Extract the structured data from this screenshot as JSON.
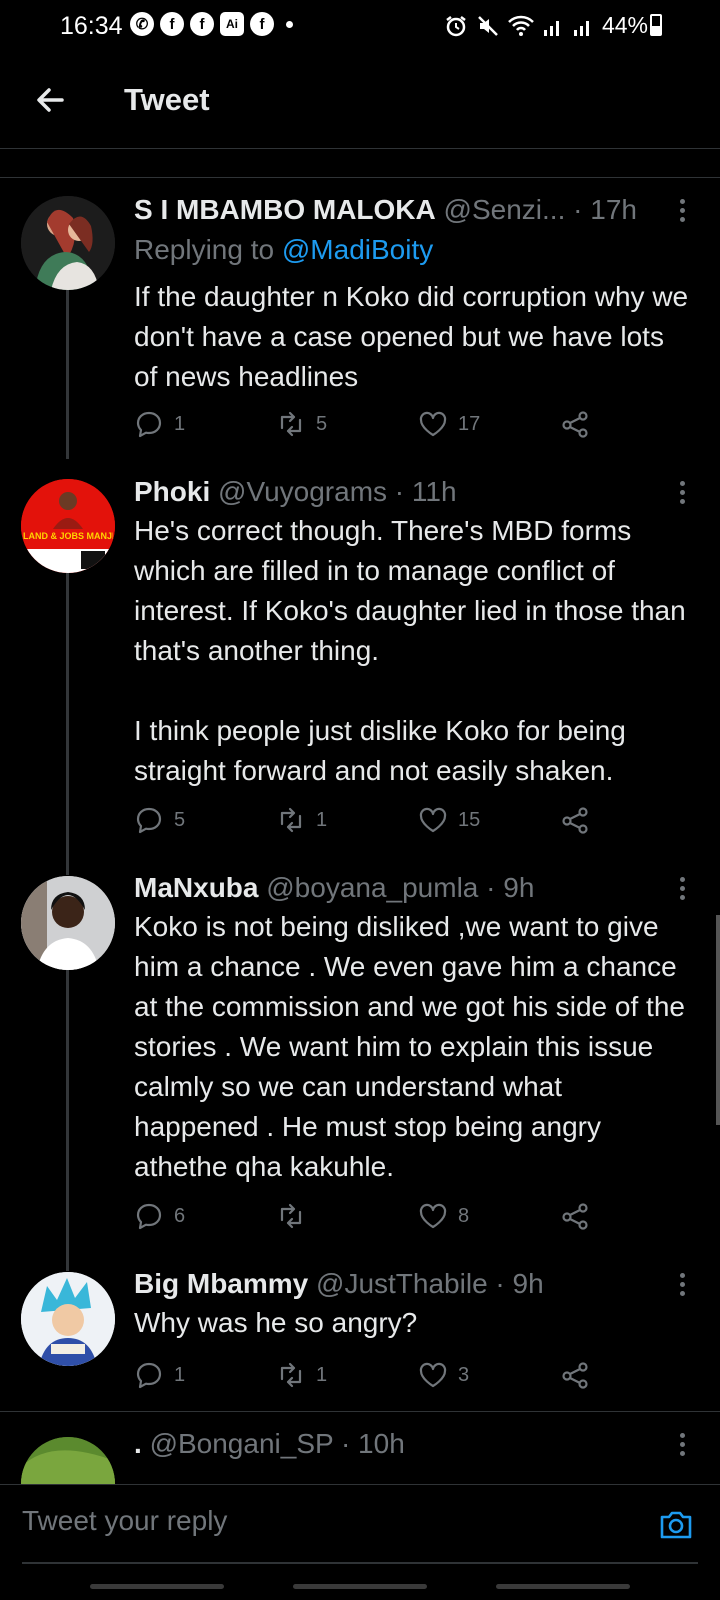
{
  "status_bar": {
    "time": "16:34",
    "notification_icons": [
      "whatsapp-icon",
      "facebook-icon",
      "facebook-icon",
      "ai-icon",
      "facebook-icon"
    ],
    "ai_label": "Ai",
    "battery_text": "44%",
    "battery_level": 0.44
  },
  "header": {
    "title": "Tweet"
  },
  "tweets": [
    {
      "name": "S I MBAMBO MALOKA",
      "handle": "@Senzi...",
      "time": "· 17h",
      "replying_label": "Replying to",
      "replying_to": "@MadiBoity",
      "text": "If the daughter n Koko did corruption why we don't have a case opened but we have lots of news headlines",
      "replies": "1",
      "retweets": "5",
      "likes": "17"
    },
    {
      "name": "Phoki",
      "handle": "@Vuyograms",
      "time": "· 11h",
      "avatar_text": "LAND & JOBS MANJE!",
      "text": "He's correct though.  There's MBD forms which are filled in to manage conflict of interest.  If Koko's daughter lied in those than that's another thing.\n\nI think people just dislike Koko for being straight forward and not easily shaken.",
      "replies": "5",
      "retweets": "1",
      "likes": "15"
    },
    {
      "name": "MaNxuba",
      "handle": "@boyana_pumla",
      "time": "· 9h",
      "text": "Koko is not being disliked ,we want to give him a chance . We even gave him a chance at the commission and we got his side of the stories . We want him to explain this issue calmly so we can understand what happened . He must stop being angry athethe qha kakuhle.",
      "replies": "6",
      "retweets": "",
      "likes": "8"
    },
    {
      "name": "Big Mbammy",
      "handle": "@JustThabile",
      "time": "· 9h",
      "text": "Why was he so angry?",
      "replies": "1",
      "retweets": "1",
      "likes": "3"
    },
    {
      "name": ".",
      "handle": "@Bongani_SP",
      "time": "· 10h"
    }
  ],
  "reply_bar": {
    "placeholder": "Tweet your reply"
  },
  "colors": {
    "background": "#000000",
    "accent": "#1d9bf0",
    "secondary_text": "#71767b",
    "divider": "#2f3336"
  }
}
